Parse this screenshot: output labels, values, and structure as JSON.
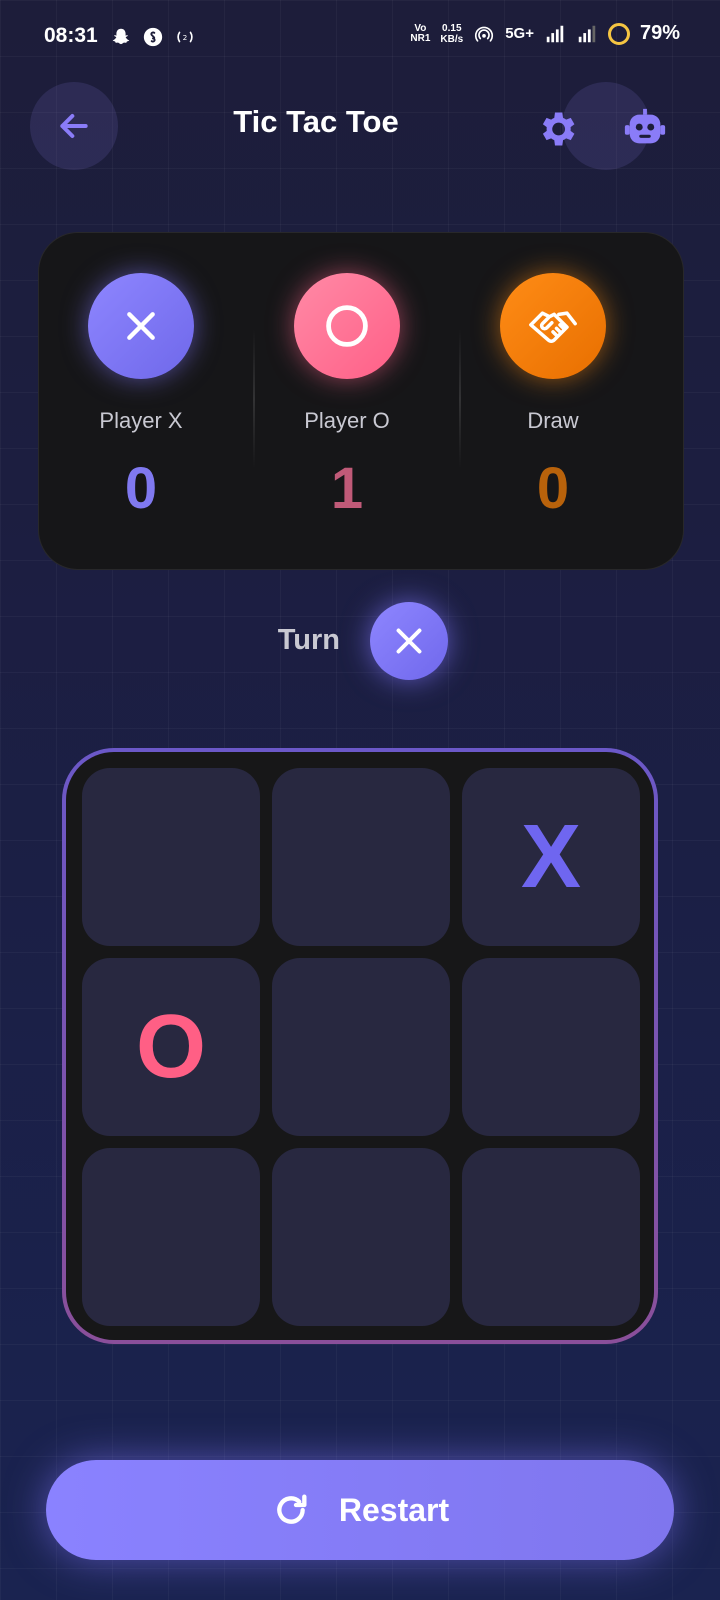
{
  "status_bar": {
    "time": "08:31",
    "net_badge_top": "Vo",
    "net_badge_bottom": "NR1",
    "speed_value": "0.15",
    "speed_unit": "KB/s",
    "network_type": "5G+",
    "battery": "79%",
    "left_icons": [
      "snapchat-icon",
      "shazam-icon",
      "nfc-icon"
    ],
    "right_icons": [
      "hotspot-icon",
      "signal-icon",
      "signal-icon",
      "battery-ring-icon"
    ]
  },
  "header": {
    "title": "Tic Tac Toe",
    "back_icon": "arrow-left-icon",
    "settings_icon": "gear-icon",
    "bot_icon": "robot-icon",
    "accent": "#8a7cf8"
  },
  "scoreboard": [
    {
      "label": "Player X",
      "score": "0",
      "icon": "x-icon",
      "color": "#8079f0"
    },
    {
      "label": "Player O",
      "score": "1",
      "icon": "circle-icon",
      "color": "#c05a78"
    },
    {
      "label": "Draw",
      "score": "0",
      "icon": "handshake-icon",
      "color": "#b8620b"
    }
  ],
  "turn": {
    "label": "Turn",
    "current": "x-icon"
  },
  "board": {
    "cells": [
      "",
      "",
      "X",
      "O",
      "",
      "",
      "",
      "",
      ""
    ],
    "x_color": "#6f66f0",
    "o_color": "#ff5f85"
  },
  "restart": {
    "label": "Restart",
    "icon": "refresh-icon"
  }
}
